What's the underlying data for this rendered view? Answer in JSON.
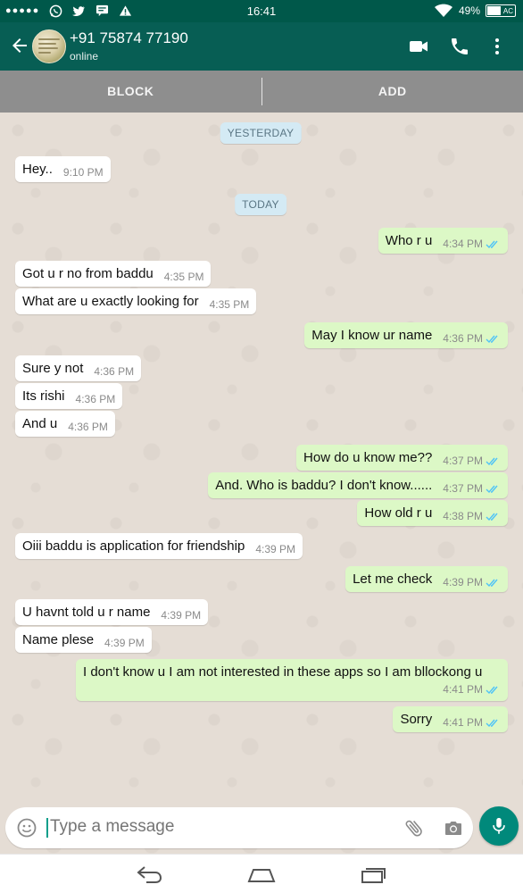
{
  "status_bar": {
    "time": "16:41",
    "battery_percent": "49%",
    "battery_level": 0.49,
    "charging_label": "AC",
    "notification_icons": [
      "dots-icon",
      "whatsapp-icon",
      "twitter-icon",
      "chat-icon",
      "warning-icon"
    ],
    "right_icons": [
      "wifi-icon",
      "battery-icon"
    ]
  },
  "header": {
    "contact_name": "+91 75874 77190",
    "contact_status": "online",
    "actions": [
      "video-call-icon",
      "phone-icon",
      "more-options-icon"
    ]
  },
  "action_bar": {
    "block_label": "BLOCK",
    "add_label": "ADD"
  },
  "chat": {
    "date_labels": {
      "yesterday": "YESTERDAY",
      "today": "TODAY"
    },
    "messages": [
      {
        "dir": "in",
        "text": "Hey..",
        "time": "9:10 PM"
      },
      {
        "dir": "out",
        "text": "Who r u",
        "time": "4:34 PM",
        "status": "read"
      },
      {
        "dir": "in",
        "text": "Got u r no from baddu",
        "time": "4:35 PM"
      },
      {
        "dir": "in",
        "text": "What are u exactly looking for",
        "time": "4:35 PM"
      },
      {
        "dir": "out",
        "text": "May I know ur name",
        "time": "4:36 PM",
        "status": "read"
      },
      {
        "dir": "in",
        "text": "Sure y not",
        "time": "4:36 PM"
      },
      {
        "dir": "in",
        "text": "Its rishi",
        "time": "4:36 PM"
      },
      {
        "dir": "in",
        "text": "And u",
        "time": "4:36 PM"
      },
      {
        "dir": "out",
        "text": "How do u know me??",
        "time": "4:37 PM",
        "status": "read"
      },
      {
        "dir": "out",
        "text": "And.  Who is baddu?  I don't know......",
        "time": "4:37 PM",
        "status": "read"
      },
      {
        "dir": "out",
        "text": "How old r u",
        "time": "4:38 PM",
        "status": "read"
      },
      {
        "dir": "in",
        "text": "Oiii baddu is application for friendship",
        "time": "4:39 PM"
      },
      {
        "dir": "out",
        "text": "Let me check",
        "time": "4:39 PM",
        "status": "read"
      },
      {
        "dir": "in",
        "text": "U havnt told u r name",
        "time": "4:39 PM"
      },
      {
        "dir": "in",
        "text": "Name plese",
        "time": "4:39 PM"
      },
      {
        "dir": "out",
        "text": "I don't know u I am not interested in these apps so I am bllockong u",
        "time": "4:41 PM",
        "status": "read"
      },
      {
        "dir": "out",
        "text": "Sorry",
        "time": "4:41 PM",
        "status": "read"
      }
    ]
  },
  "input": {
    "placeholder": "Type a message",
    "value": ""
  },
  "colors": {
    "header": "#075e54",
    "status_bar": "#00584a",
    "incoming_bubble": "#ffffff",
    "outgoing_bubble": "#dcf8c6",
    "chat_background": "#e5ddd5",
    "read_ticks": "#4fc3f7",
    "mic_button": "#00897b"
  },
  "nav_bar": {
    "icons": [
      "back-nav-icon",
      "home-nav-icon",
      "recents-nav-icon"
    ]
  }
}
